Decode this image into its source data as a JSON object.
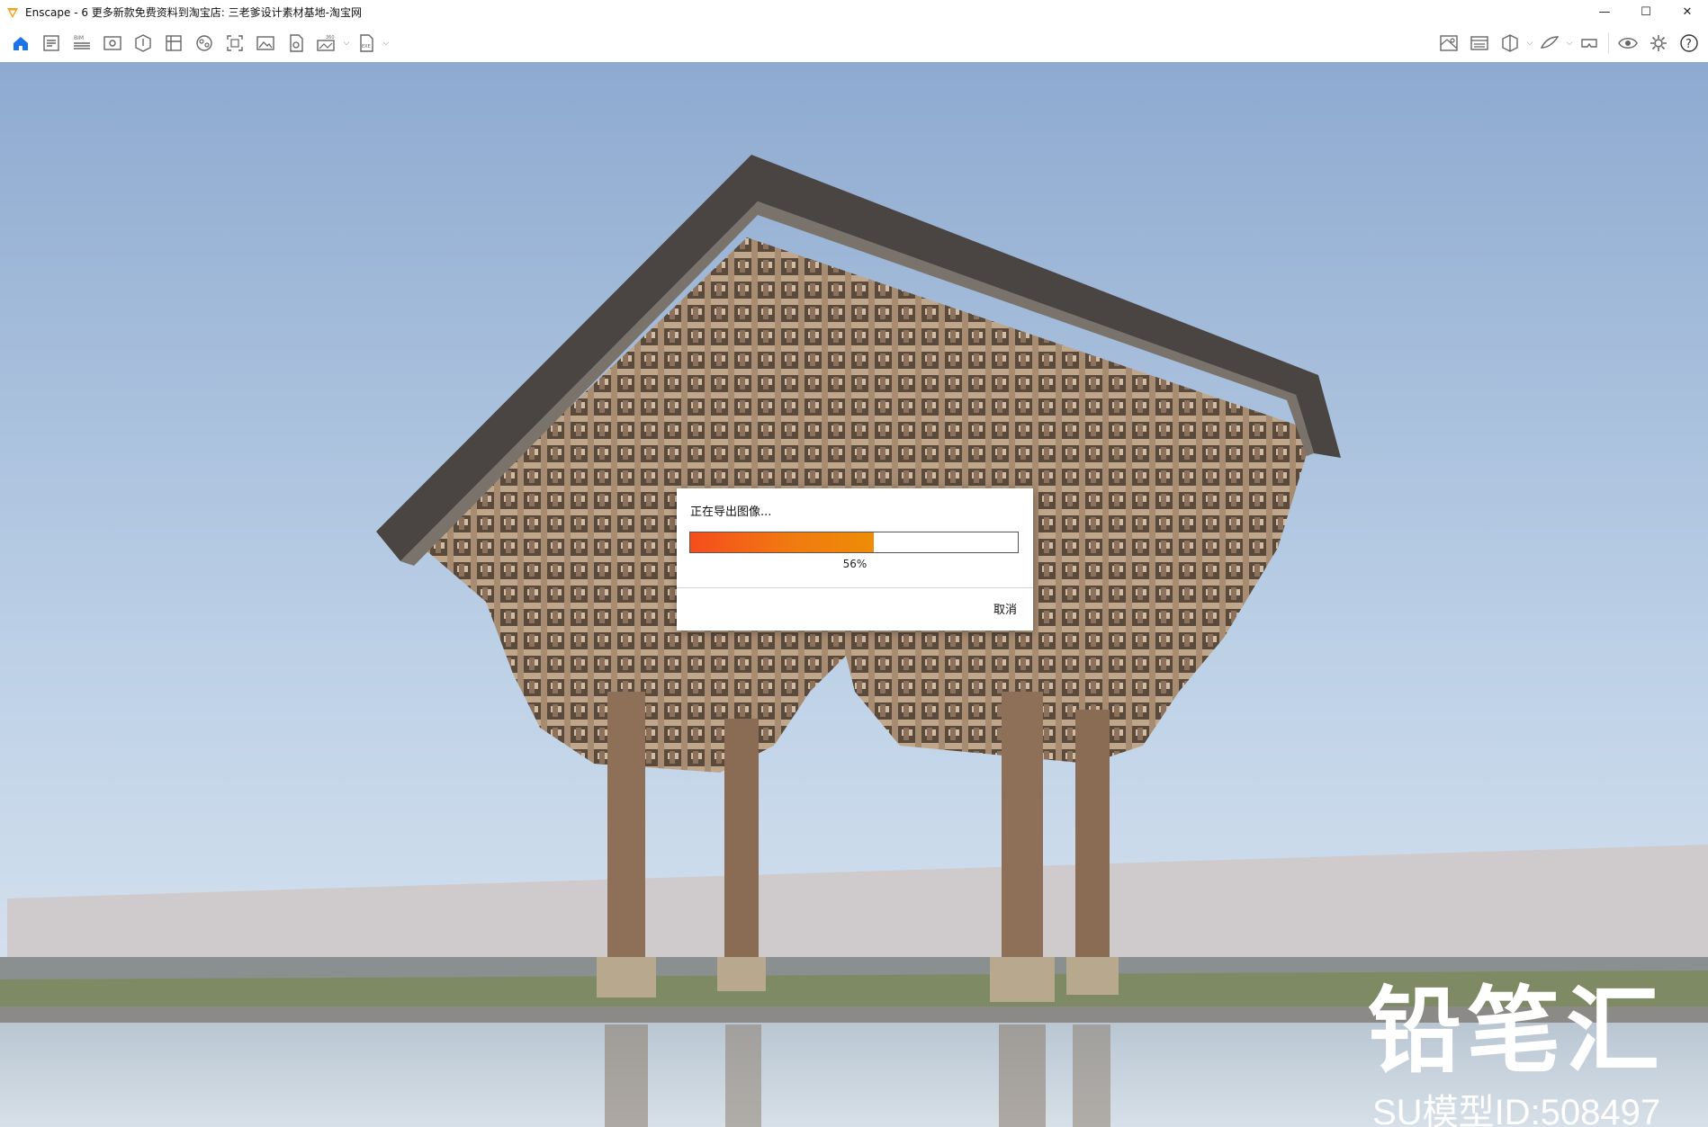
{
  "window": {
    "title": "Enscape - 6  更多新款免费资料到淘宝店: 三老爹设计素材基地-淘宝网",
    "controls": {
      "minimize": "—",
      "maximize": "☐",
      "close": "✕"
    }
  },
  "toolbar": {
    "left_icons": [
      "home-icon",
      "project-info-icon",
      "bim-icon",
      "view-icon",
      "asset-library-icon",
      "material-editor-icon",
      "atmosphere-icon",
      "batch-render-icon",
      "screenshot-icon",
      "video-editor-icon",
      "panorama-icon",
      "export-exe-icon"
    ],
    "bim_badge": "BIM",
    "pano_badge": "360",
    "exe_badge": "EXE",
    "right_icons": [
      "map-icon",
      "visual-settings-icon",
      "view-cube-icon",
      "sketch-icon",
      "vr-headset-icon",
      "eye-icon",
      "gear-icon",
      "help-icon"
    ],
    "help_label": "?"
  },
  "watermark": {
    "logo_text": "铅笔汇",
    "model_id": "SU模型ID:508497"
  },
  "dialog": {
    "title": "正在导出图像...",
    "progress": 0.56,
    "percent_label": "56%",
    "cancel_label": "取消"
  },
  "colors": {
    "accent": "#1a73e8",
    "progress_start": "#f44d1d",
    "progress_end": "#ee8c07",
    "logo_orange": "#f5a21b"
  }
}
